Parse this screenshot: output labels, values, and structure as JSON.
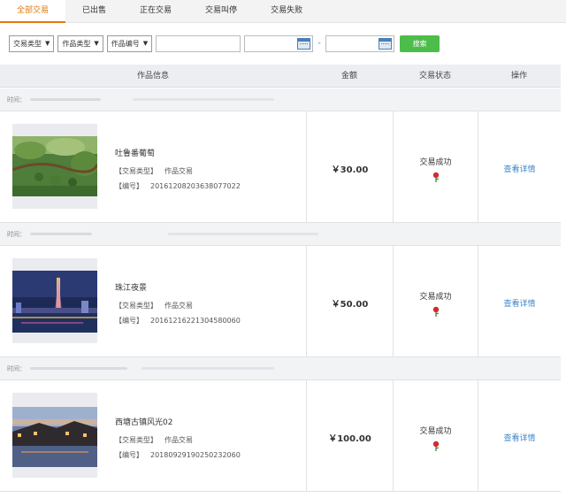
{
  "tabs": [
    "全部交易",
    "已出售",
    "正在交易",
    "交易叫停",
    "交易失败"
  ],
  "active_tab": 0,
  "filters": {
    "trade_type": "交易类型",
    "work_type": "作品类型",
    "work_id": "作品编号",
    "date_separator": "-",
    "search_label": "搜索"
  },
  "table": {
    "headers": [
      "作品信息",
      "金额",
      "交易状态",
      "操作"
    ],
    "time_label": "时间：",
    "type_key": "【交易类型】",
    "id_key": "【编号】",
    "detail_label": "查看详情",
    "rows": [
      {
        "title": "吐鲁番葡萄",
        "type": "作品交易",
        "id": "20161208203638077022",
        "amount": "￥30.00",
        "status": "交易成功",
        "image": "grapes"
      },
      {
        "title": "珠江夜景",
        "type": "作品交易",
        "id": "20161216221304580060",
        "amount": "￥50.00",
        "status": "交易成功",
        "image": "night-city"
      },
      {
        "title": "西塘古镇风光02",
        "type": "作品交易",
        "id": "20180929190250232060",
        "amount": "￥100.00",
        "status": "交易成功",
        "image": "water-town"
      }
    ]
  },
  "colors": {
    "accent": "#e07b10",
    "search": "#4cbd4a",
    "link": "#3a86c8"
  }
}
